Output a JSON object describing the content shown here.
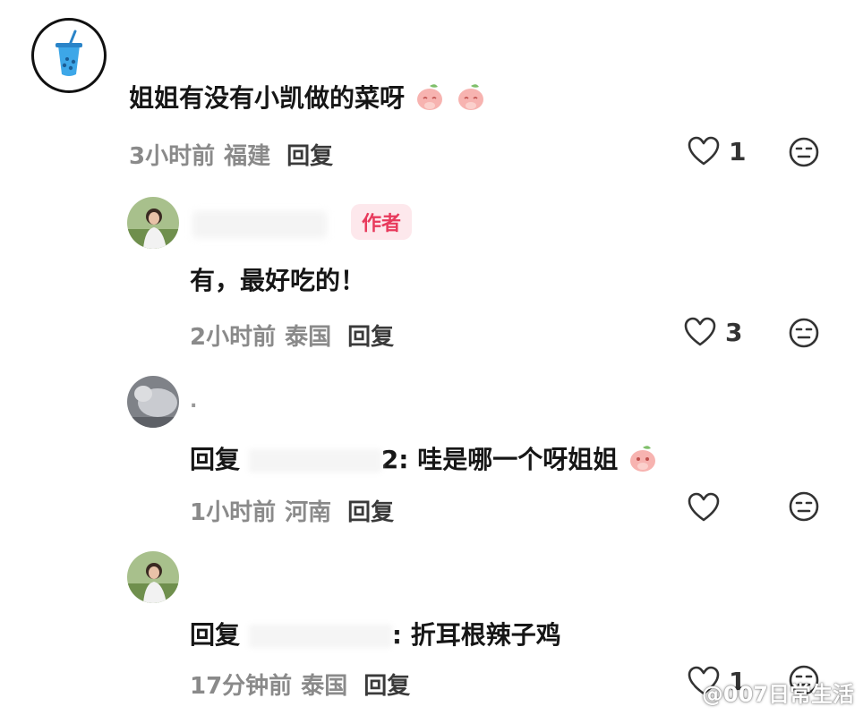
{
  "comments": [
    {
      "text": "姐姐有没有小凯做的菜呀",
      "time": "3小时前",
      "location": "福建",
      "reply_label": "回复",
      "likes": "1"
    },
    {
      "badge": "作者",
      "text": "有，最好吃的！",
      "time": "2小时前",
      "location": "泰国",
      "reply_label": "回复",
      "likes": "3"
    },
    {
      "name_fragment": ".",
      "reply_prefix": "回复",
      "mention_tail": "2:",
      "text": "哇是哪一个呀姐姐",
      "time": "1小时前",
      "location": "河南",
      "reply_label": "回复",
      "likes": ""
    },
    {
      "reply_prefix": "回复",
      "mention_tail": ":",
      "text": "折耳根辣子鸡",
      "time": "17分钟前",
      "location": "泰国",
      "reply_label": "回复",
      "likes": "1"
    }
  ],
  "watermark": "@007日常生活",
  "icons": {
    "like": "heart-outline-icon",
    "dislike": "neutral-face-icon",
    "emoji": "peach-shy-emoji",
    "avatar_main": "bubble-tea-icon"
  },
  "colors": {
    "badge_text": "#e83a5c",
    "badge_bg": "#fde8ec",
    "meta": "#8a8a8a"
  }
}
